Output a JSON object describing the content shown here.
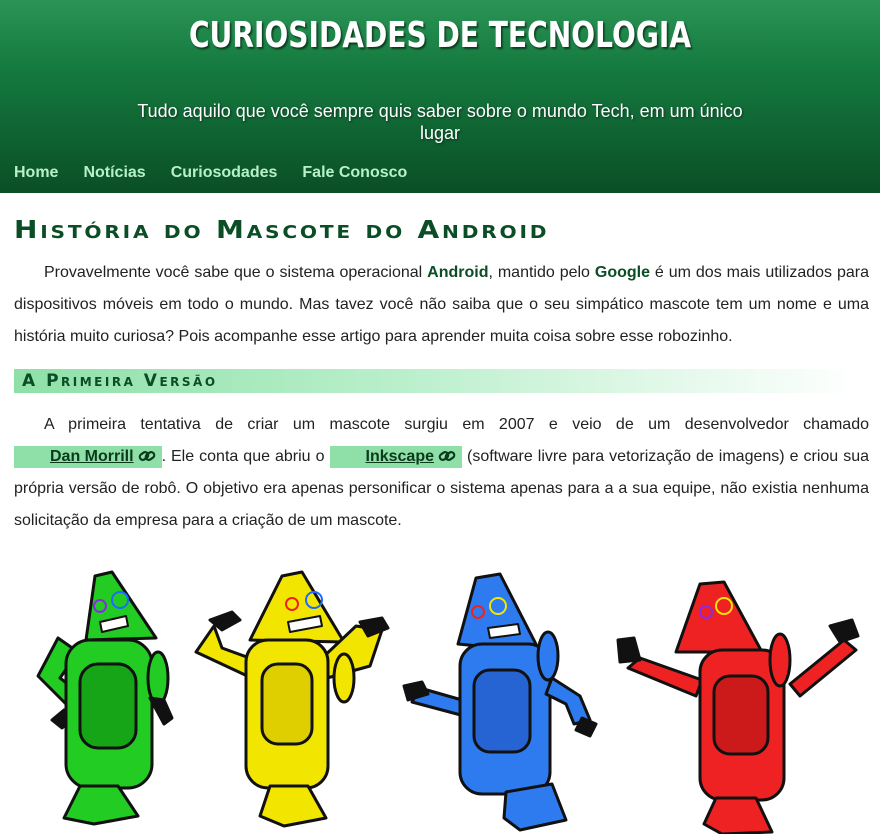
{
  "header": {
    "title": "CURIOSIDADES DE TECNOLOGIA",
    "subtitle": "Tudo aquilo que você sempre quis saber sobre o mundo Tech, em um único lugar"
  },
  "nav": {
    "items": [
      {
        "label": "Home"
      },
      {
        "label": "Notícias"
      },
      {
        "label": "Curiosodades"
      },
      {
        "label": "Fale Conosco"
      }
    ]
  },
  "article": {
    "title": "História do Mascote do Android",
    "intro": {
      "part1": "Provavelmente você sabe que o sistema operacional ",
      "android": "Android",
      "part2": ", mantido pelo ",
      "google": "Google",
      "part3": " é um dos mais utilizados para dispositivos móveis em todo o mundo. Mas tavez você não saiba que o seu simpático mascote tem um nome e uma história muito curiosa? Pois acompanhe esse artigo para aprender muita coisa sobre esse robozinho."
    },
    "section1": {
      "title": "A Primeira Versão",
      "part1": "A primeira tentativa de criar um mascote surgiu em 2007 e veio de um desenvolvedor chamado ",
      "link1": "Dan Morrill",
      "part2": ". Ele conta que abriu o ",
      "link2": "Inkscape",
      "part3": " (software livre para vetorização de imagens) e criou sua própria versão de robô. O objetivo era apenas personificar o sistema apenas para a a sua equipe, não existia nenhuma solicitação da empresa para a criação de um mascote."
    }
  },
  "colors": {
    "header_top": "#2a9455",
    "header_bottom": "#0a4f26",
    "nav_link": "#b8f0c8",
    "title_green": "#0b4d24",
    "chip_bg": "#8ee0a8",
    "robot_colors": [
      "#22cc22",
      "#f2e600",
      "#2e7bf0",
      "#ee2222"
    ]
  },
  "icons": {
    "link": "chain-link-icon"
  }
}
